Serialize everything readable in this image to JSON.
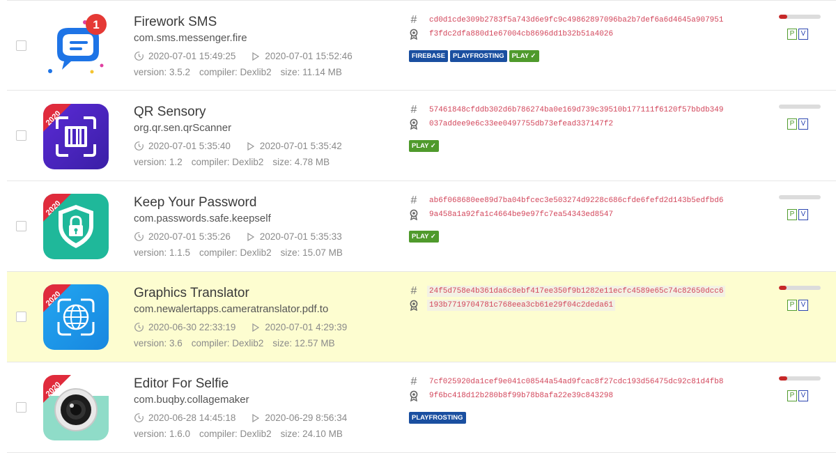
{
  "apps": [
    {
      "title": "Firework SMS",
      "package": "com.sms.messenger.fire",
      "first_seen": "2020-07-01 15:49:25",
      "analyzed": "2020-07-01 15:52:46",
      "version": "version: 3.5.2",
      "compiler": "compiler: Dexlib2",
      "size": "size: 11.14 MB",
      "sha": "cd0d1cde309b2783f5a743d6e9fc9c49862897096ba2b7def6a6d4645a907951",
      "cert": "f3fdc2dfa880d1e67004cb8696dd1b32b51a4026",
      "tags": [
        {
          "label": "FIREBASE",
          "color": "blue"
        },
        {
          "label": "PLAYFROSTING",
          "color": "blue"
        },
        {
          "label": "PLAY ✓",
          "color": "green"
        }
      ],
      "risk_fraction": 0.2,
      "badge": "1",
      "p_label": "P",
      "v_label": "V"
    },
    {
      "title": "QR Sensory",
      "package": "org.qr.sen.qrScanner",
      "first_seen": "2020-07-01 5:35:40",
      "analyzed": "2020-07-01 5:35:42",
      "version": "version: 1.2",
      "compiler": "compiler: Dexlib2",
      "size": "size: 4.78 MB",
      "sha": "57461848cfddb302d6b786274ba0e169d739c39510b177111f6120f57bbdb349",
      "cert": "037addee9e6c33ee0497755db73efead337147f2",
      "tags": [
        {
          "label": "PLAY ✓",
          "color": "green"
        }
      ],
      "risk_fraction": 0,
      "ribbon": "2020",
      "p_label": "P",
      "v_label": "V"
    },
    {
      "title": "Keep Your Password",
      "package": "com.passwords.safe.keepself",
      "first_seen": "2020-07-01 5:35:26",
      "analyzed": "2020-07-01 5:35:33",
      "version": "version: 1.1.5",
      "compiler": "compiler: Dexlib2",
      "size": "size: 15.07 MB",
      "sha": "ab6f068680ee89d7ba04bfcec3e503274d9228c686cfde6fefd2d143b5edfbd6",
      "cert": "9a458a1a92fa1c4664be9e97fc7ea54343ed8547",
      "tags": [
        {
          "label": "PLAY ✓",
          "color": "green"
        }
      ],
      "risk_fraction": 0,
      "ribbon": "2020",
      "p_label": "P",
      "v_label": "V"
    },
    {
      "title": "Graphics Translator",
      "package": "com.newalertapps.cameratranslator.pdf.to",
      "first_seen": "2020-06-30 22:33:19",
      "analyzed": "2020-07-01 4:29:39",
      "version": "version: 3.6",
      "compiler": "compiler: Dexlib2",
      "size": "size: 12.57 MB",
      "sha": "24f5d758e4b361da6c8ebf417ee350f9b1282e11ecfc4589e65c74c82650dcc6",
      "cert": "193b7719704781c768eea3cb61e29f04c2deda61",
      "tags": [],
      "risk_fraction": 0.18,
      "ribbon": "2020",
      "p_label": "P",
      "v_label": "V"
    },
    {
      "title": "Editor For Selfie",
      "package": "com.buqby.collagemaker",
      "first_seen": "2020-06-28 14:45:18",
      "analyzed": "2020-06-29 8:56:34",
      "version": "version: 1.6.0",
      "compiler": "compiler: Dexlib2",
      "size": "size: 24.10 MB",
      "sha": "7cf025920da1cef9e041c08544a54ad9fcac8f27cdc193d56475dc92c81d4fb8",
      "cert": "9f6bc418d12b280b8f99b78b8afa22e39c843298",
      "tags": [
        {
          "label": "PLAYFROSTING",
          "color": "blue"
        }
      ],
      "risk_fraction": 0.2,
      "ribbon": "2020",
      "p_label": "P",
      "v_label": "V"
    }
  ],
  "icons": {
    "hash": "#",
    "first_seen": "history-clock-icon",
    "analyzed": "play-triangle-icon",
    "certificate": "certificate-ribbon-icon"
  },
  "colors": {
    "tag_blue": "#1a4fa0",
    "tag_green": "#4f9a2c",
    "hash_text": "#d2455a",
    "risk_bar": "#c62828",
    "highlight_row": "#fdfdd0"
  }
}
